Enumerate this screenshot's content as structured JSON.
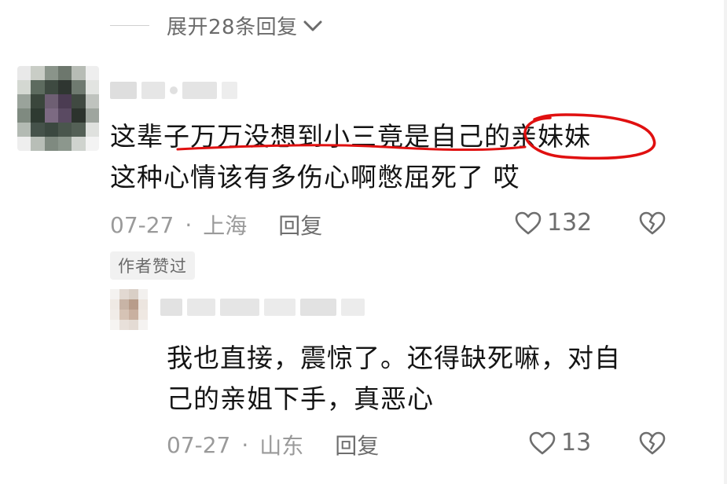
{
  "expand": {
    "label": "展开28条回复"
  },
  "comment": {
    "line1": "这辈子万万没想到小三竟是自己的亲妹妹",
    "line2": "这种心情该有多伤心啊憋屈死了 哎",
    "date": "07-27",
    "location": "上海",
    "reply_label": "回复",
    "likes": "132",
    "badge": "作者赞过"
  },
  "reply": {
    "line1": "我也直接，震惊了。还得缺死嘛，对自",
    "line2": "己的亲姐下手，真恶心",
    "date": "07-27",
    "location": "山东",
    "reply_label": "回复",
    "likes": "13"
  },
  "separator": "·",
  "icons": {
    "expand": "chevron-down-icon",
    "like": "heart-outline-icon",
    "dislike": "broken-heart-icon"
  },
  "colors": {
    "annotation": "#e01010",
    "meta_text": "#9a9a9a",
    "body_text": "#141414"
  }
}
